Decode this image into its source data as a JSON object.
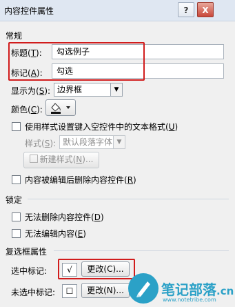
{
  "window": {
    "title": "内容控件属性",
    "help": "?",
    "close": "X"
  },
  "general": {
    "section": "常规",
    "title_label": "标题",
    "title_key": "T",
    "title_value": "勾选例子",
    "tag_label": "标记",
    "tag_key": "A",
    "tag_value": "勾选",
    "show_as_label": "显示为",
    "show_as_key": "S",
    "show_as_value": "边界框",
    "color_label": "颜色",
    "color_key": "C",
    "use_style_text": "使用样式设置键入空控件中的文本格式",
    "use_style_key": "U",
    "style_label": "样式",
    "style_key": "S",
    "style_value": "默认段落字体",
    "new_style_text": "新建样式",
    "new_style_key": "N",
    "remove_text": "内容被编辑后删除内容控件",
    "remove_key": "R"
  },
  "locking": {
    "section": "锁定",
    "no_delete_text": "无法删除内容控件",
    "no_delete_key": "D",
    "no_edit_text": "无法编辑内容",
    "no_edit_key": "E"
  },
  "checkbox_props": {
    "section": "复选框属性",
    "checked_label": "选中标记:",
    "checked_symbol": "√",
    "checked_change": "更改(C)...",
    "unchecked_label": "未选中标记:",
    "unchecked_symbol": "☐",
    "unchecked_change": "更改(N)..."
  },
  "watermark": {
    "name": "笔记部落",
    "domain": ".cn",
    "url": "www.notetribe.com"
  },
  "colors": {
    "red_highlight": "#d11c1c",
    "titlebar": "#dfe7f2",
    "watermark": "#2ba1c7"
  }
}
